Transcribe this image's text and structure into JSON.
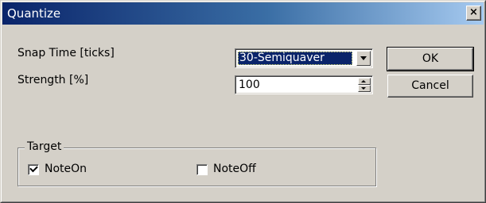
{
  "window": {
    "title": "Quantize",
    "close_label": "×"
  },
  "fields": {
    "snap_time_label": "Snap Time [ticks]",
    "snap_time_value": "30-Semiquaver",
    "strength_label": "Strength [%]",
    "strength_value": "100"
  },
  "buttons": {
    "ok_label": "OK",
    "cancel_label": "Cancel"
  },
  "target": {
    "group_label": "Target",
    "noteon_label": "NoteOn",
    "noteon_checked": true,
    "noteoff_label": "NoteOff",
    "noteoff_checked": false
  },
  "icons": [
    "close-icon",
    "dropdown-arrow-icon",
    "spin-up-icon",
    "spin-down-icon",
    "checkmark-icon"
  ],
  "colors": {
    "face": "#d4d0c8",
    "title_start": "#0a246a",
    "title_end": "#a6caf0",
    "selection": "#0a246a"
  }
}
